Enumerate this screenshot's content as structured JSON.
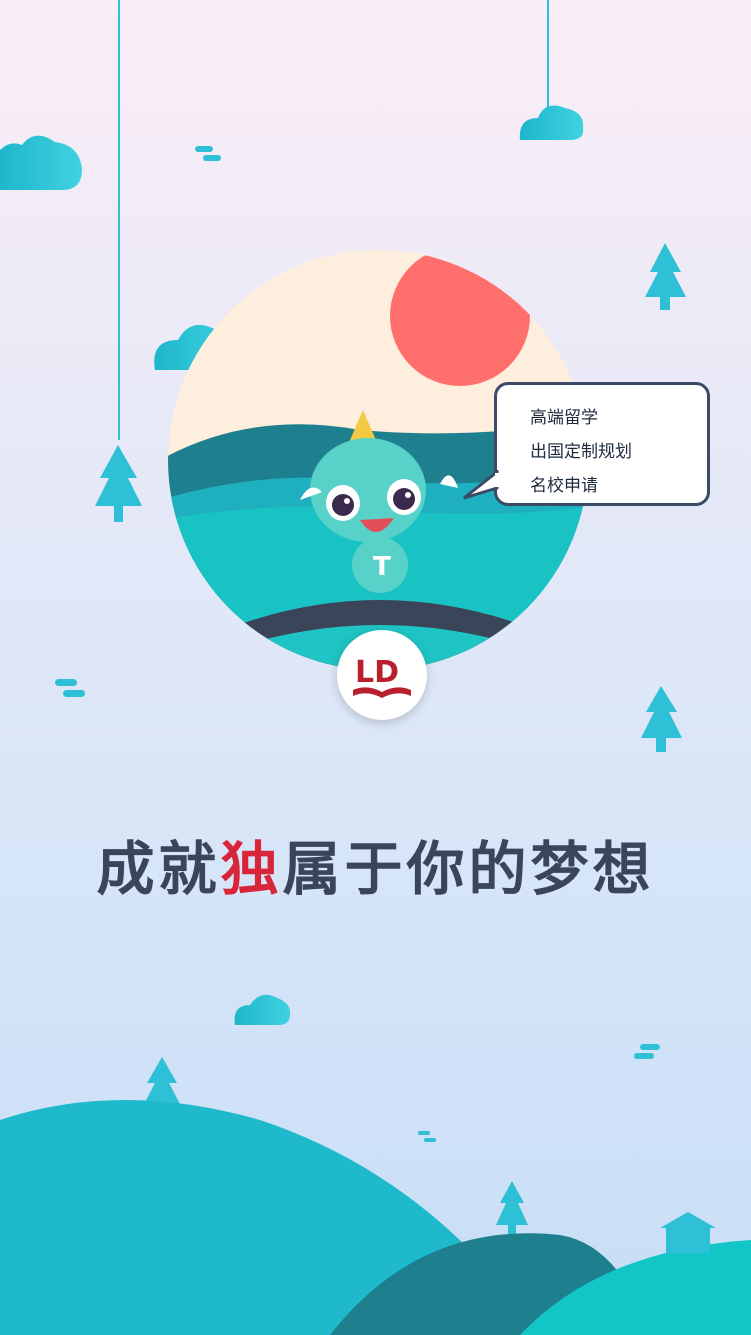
{
  "bubble": {
    "line1": "高端留学",
    "line2": "出国定制规划",
    "line3": "名校申请"
  },
  "headline": {
    "part1": "成就",
    "highlight": "独",
    "part2": "属于你的梦想"
  },
  "logo": {
    "text": "LD"
  },
  "colors": {
    "teal": "#2dc0d6",
    "dark_teal": "#1e7f8f",
    "sun": "#ff6f6b",
    "navy": "#3a4559",
    "accent_red": "#d8253a"
  }
}
